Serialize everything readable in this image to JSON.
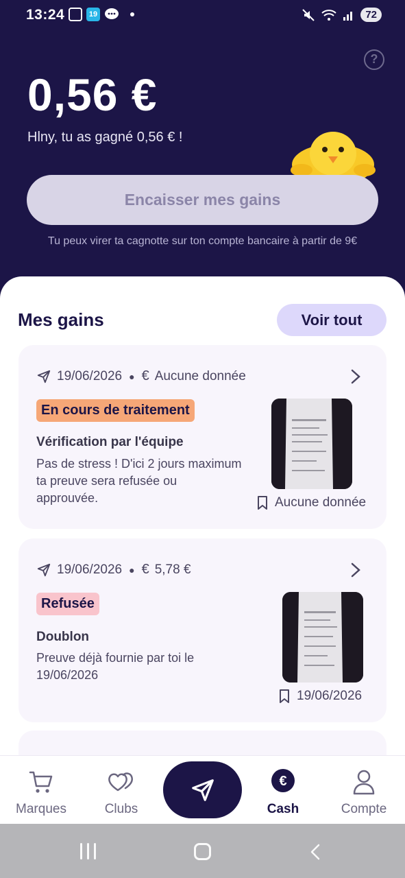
{
  "status_bar": {
    "time": "13:24",
    "notif_icons": [
      "screen-record-icon",
      "badge-19-icon",
      "chat-bubble-icon",
      "dot-icon"
    ],
    "badge_text": "19",
    "battery": "72",
    "right_icons": [
      "mute-icon",
      "wifi-icon",
      "signal-icon"
    ]
  },
  "header": {
    "balance": "0,56 €",
    "greeting": "Hlny, tu as gagné 0,56 € !",
    "cashout_button": "Encaisser mes gains",
    "cashout_hint": "Tu peux virer ta cagnotte sur ton compte bancaire à partir de 9€"
  },
  "gains": {
    "title": "Mes gains",
    "see_all": "Voir tout",
    "cards": [
      {
        "date": "19/06/2026",
        "amount": "Aucune donnée",
        "badge": "En cours de traitement",
        "status_title": "Vérification par l'équipe",
        "status_desc": "Pas de stress ! D'ici 2 jours maximum ta preuve sera refusée ou approuvée.",
        "receipt_label": "Aucune donnée"
      },
      {
        "date": "19/06/2026",
        "amount": "5,78 €",
        "badge": "Refusée",
        "status_title": "Doublon",
        "status_desc": "Preuve déjà fournie par toi le 19/06/2026",
        "receipt_label": "19/06/2026"
      }
    ]
  },
  "bottom_nav": {
    "brands": "Marques",
    "clubs": "Clubs",
    "cash": "Cash",
    "account": "Compte",
    "active": "Cash"
  },
  "colors": {
    "header_bg": "#1c1547",
    "accent_light": "#ddd8fb",
    "badge_processing": "#f6a777",
    "badge_refused": "#f9c4cc"
  }
}
